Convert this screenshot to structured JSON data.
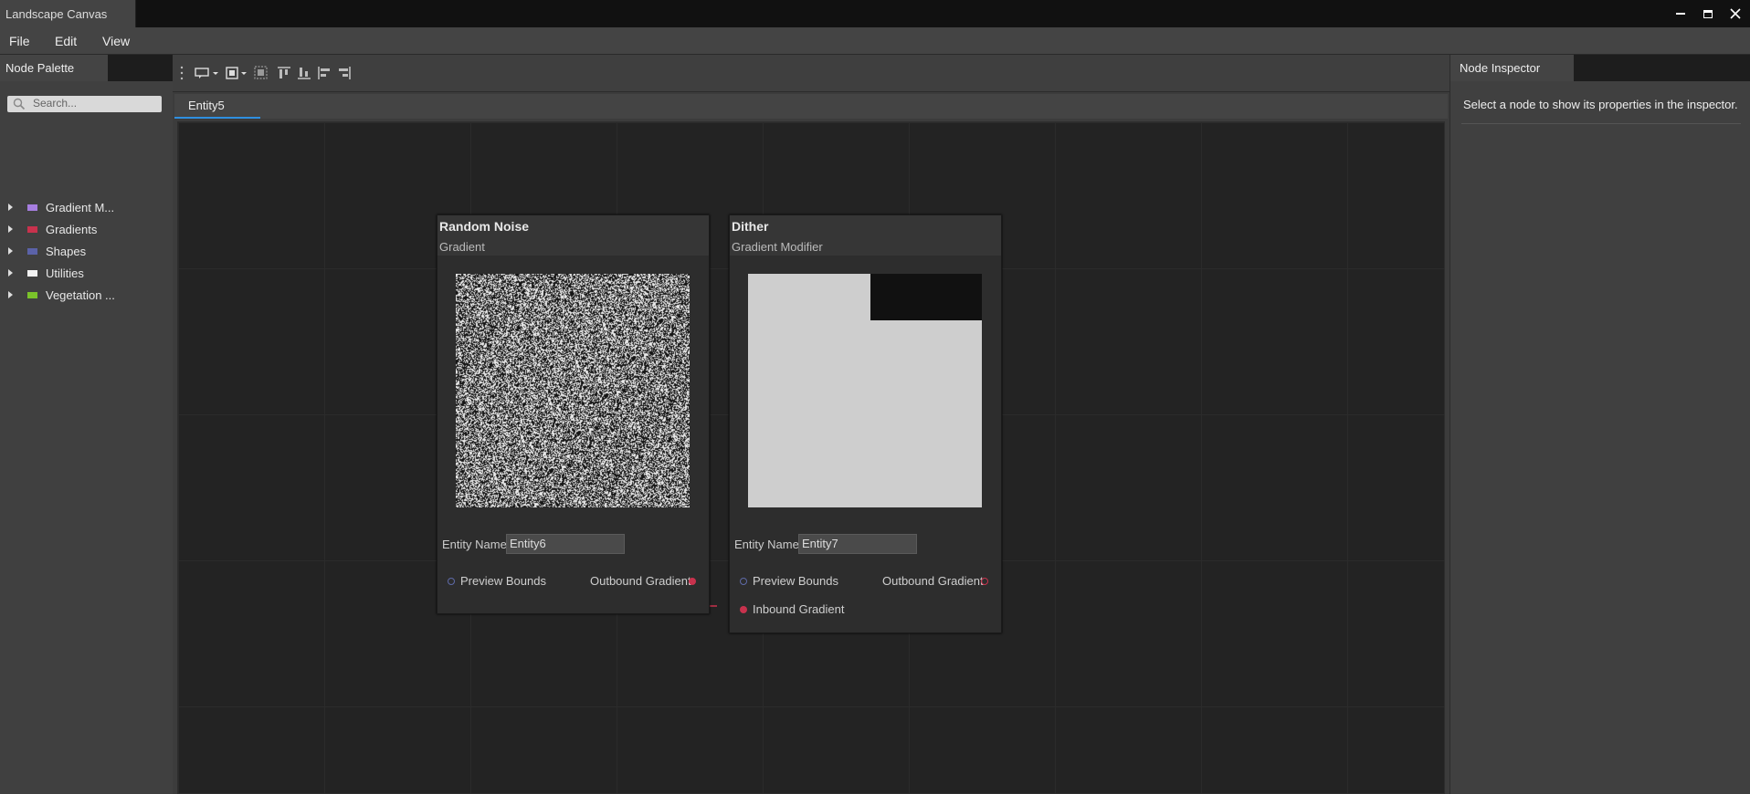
{
  "window": {
    "title": "Landscape Canvas",
    "controls": [
      "minimize-icon",
      "maximize-icon",
      "close-icon"
    ]
  },
  "menu": [
    {
      "label": "File"
    },
    {
      "label": "Edit"
    },
    {
      "label": "View"
    }
  ],
  "palette": {
    "tab_label": "Node Palette",
    "search_placeholder": "Search...",
    "items": [
      {
        "label": "Gradient M...",
        "color": "#a67ee0"
      },
      {
        "label": "Gradients",
        "color": "#c8324d"
      },
      {
        "label": "Shapes",
        "color": "#5b62a8"
      },
      {
        "label": "Utilities",
        "color": "#f2f2f2"
      },
      {
        "label": "Vegetation ...",
        "color": "#7ac22a"
      }
    ]
  },
  "toolbar": {
    "icons": [
      "drag-handle-icon",
      "add-comment-icon",
      "group-icon",
      "ungroup-icon",
      "align-top-icon",
      "align-bottom-icon",
      "align-left-icon",
      "align-right-icon"
    ]
  },
  "document": {
    "tab_label": "Entity5"
  },
  "nodes": [
    {
      "title": "Random Noise",
      "subtitle": "Gradient",
      "entity_name_label": "Entity Name",
      "entity_name": "Entity6",
      "slots": {
        "preview_bounds": "Preview Bounds",
        "outbound_gradient": "Outbound Gradient"
      }
    },
    {
      "title": "Dither",
      "subtitle": "Gradient Modifier",
      "entity_name_label": "Entity Name",
      "entity_name": "Entity7",
      "slots": {
        "preview_bounds": "Preview Bounds",
        "outbound_gradient": "Outbound Gradient",
        "inbound_gradient": "Inbound Gradient"
      }
    }
  ],
  "inspector": {
    "tab_label": "Node Inspector",
    "message": "Select a node to show its properties in the inspector."
  },
  "colors": {
    "accent_tab": "#2f8fe0",
    "connection": "#c8324d"
  }
}
